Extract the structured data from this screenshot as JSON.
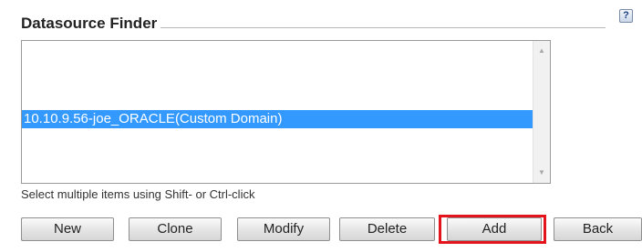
{
  "panel": {
    "title": "Datasource Finder",
    "help_label": "?"
  },
  "listbox": {
    "items": [
      {
        "label": "10.10.9.56-joe_ORACLE(Custom Domain)",
        "selected": true
      }
    ],
    "scroll_up_glyph": "▲",
    "scroll_down_glyph": "▼"
  },
  "hint": "Select multiple items using Shift- or Ctrl-click",
  "buttons": {
    "new": "New",
    "clone": "Clone",
    "modify": "Modify",
    "delete": "Delete",
    "add": "Add",
    "back": "Back"
  },
  "highlight_color": "#e3141c",
  "selection_color": "#3399ff"
}
